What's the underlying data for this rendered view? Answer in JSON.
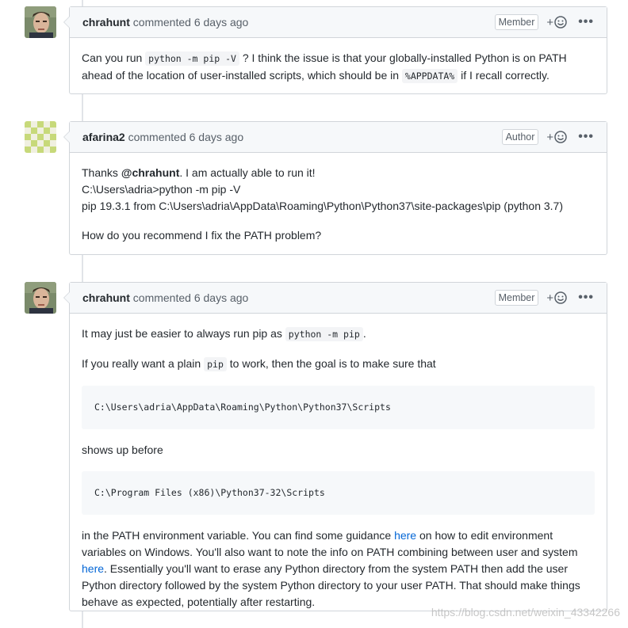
{
  "comments": [
    {
      "author": "chrahunt",
      "meta": " commented 6 days ago",
      "role": "Member",
      "reaction_plus": "+",
      "more": "•••",
      "body": {
        "t1": "Can you run ",
        "c1": "python -m pip -V",
        "t2": " ? I think the issue is that your globally-installed Python is on PATH ahead of the location of user-installed scripts, which should be in ",
        "c2": "%APPDATA%",
        "t3": " if I recall correctly."
      }
    },
    {
      "author": "afarina2",
      "meta": " commented 6 days ago",
      "role": "Author",
      "reaction_plus": "+",
      "more": "•••",
      "body": {
        "thanks": "Thanks ",
        "mention": "@chrahunt",
        "thanks_rest": ". I am actually able to run it!",
        "line2": "C:\\Users\\adria>python -m pip -V",
        "line3": "pip 19.3.1 from C:\\Users\\adria\\AppData\\Roaming\\Python\\Python37\\site-packages\\pip (python 3.7)",
        "line4": "How do you recommend I fix the PATH problem?"
      }
    },
    {
      "author": "chrahunt",
      "meta": " commented 6 days ago",
      "role": "Member",
      "reaction_plus": "+",
      "more": "•••",
      "body": {
        "p1a": "It may just be easier to always run pip as ",
        "p1c": "python -m pip",
        "p1b": ".",
        "p2a": "If you really want a plain ",
        "p2c": "pip",
        "p2b": " to work, then the goal is to make sure that",
        "pre1": "C:\\Users\\adria\\AppData\\Roaming\\Python\\Python37\\Scripts",
        "p3": "shows up before",
        "pre2": "C:\\Program Files (x86)\\Python37-32\\Scripts",
        "p4a": "in the PATH environment variable. You can find some guidance ",
        "p4link1": "here",
        "p4b": " on how to edit environment variables on Windows. You'll also want to note the info on PATH combining between user and system ",
        "p4link2": "here",
        "p4c": ". Essentially you'll want to erase any Python directory from the system PATH then add the user Python directory followed by the system Python directory to your user PATH. That should make things behave as expected, potentially after restarting."
      }
    }
  ],
  "watermark": "https://blog.csdn.net/weixin_43342266",
  "colors": {
    "link": "#0366d6",
    "header_bg": "#f6f8fa",
    "border": "#d1d5da"
  }
}
